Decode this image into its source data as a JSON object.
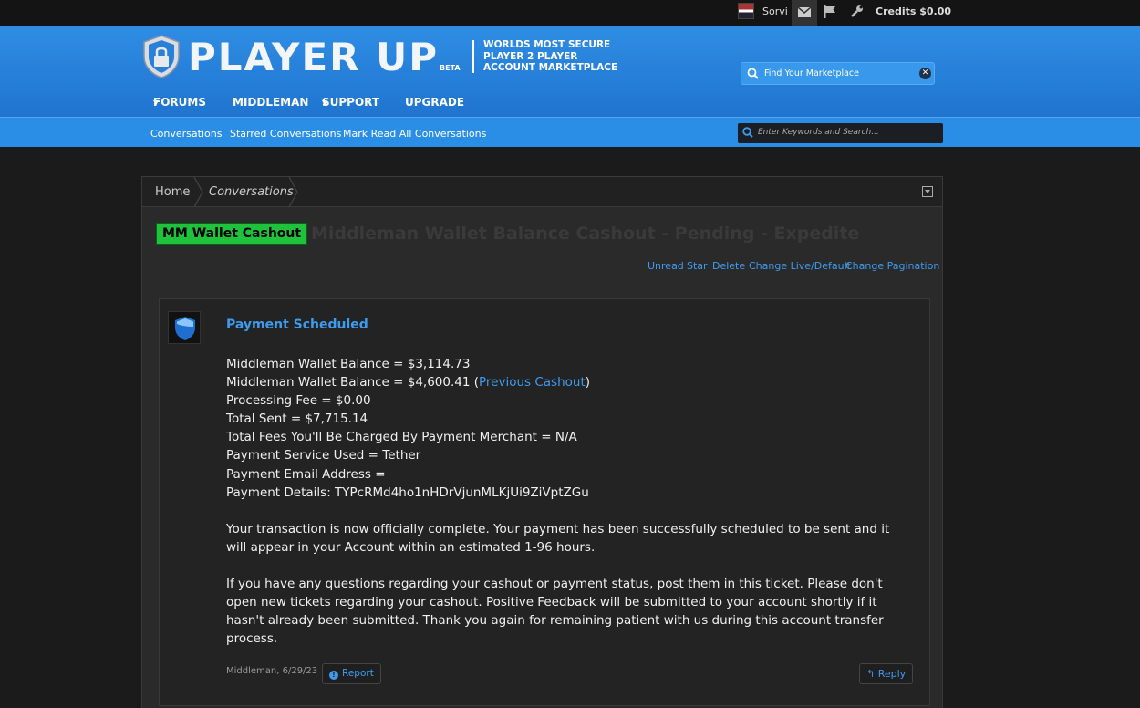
{
  "userbar": {
    "username": "Sorvi",
    "credits": "Credits $0.00",
    "icons": [
      "avatar",
      "envelope-icon",
      "flag-icon",
      "wrench-icon"
    ]
  },
  "header": {
    "logo_text": "PLAYER UP",
    "logo_beta": "BETA",
    "tagline": [
      "WORLDS MOST SECURE",
      "PLAYER 2 PLAYER",
      "ACCOUNT MARKETPLACE"
    ],
    "market_search_placeholder": "Find Your Marketplace",
    "nav": [
      {
        "label": "FORUMS",
        "dropdown": true
      },
      {
        "label": "MIDDLEMAN",
        "dropdown": false
      },
      {
        "label": "SUPPORT",
        "dropdown": true
      },
      {
        "label": "UPGRADE",
        "dropdown": false
      }
    ]
  },
  "subnav": {
    "links": [
      "Conversations",
      "Starred Conversations",
      "Mark Read All Conversations"
    ],
    "search_placeholder": "Enter Keywords and Search..."
  },
  "breadcrumb": [
    "Home",
    "Conversations"
  ],
  "thread": {
    "prefix": "MM Wallet Cashout",
    "title": "Middleman Wallet Balance Cashout - Pending - Expedite",
    "actions": [
      "Unread",
      "Star",
      "Delete",
      "Change Live/Default",
      "Change Pagination"
    ]
  },
  "message": {
    "title": "Payment Scheduled",
    "lines": {
      "l1": "Middleman Wallet Balance = $3,114.73",
      "l2_pre": "Middleman Wallet Balance = $4,600.41 (",
      "l2_link": "Previous Cashout",
      "l2_post": ")",
      "l3": "Processing Fee = $0.00",
      "l4": "Total Sent = $7,715.14",
      "l5": "Total Fees You'll Be Charged By Payment Merchant = N/A",
      "l6": "Payment Service Used = Tether",
      "l7": "Payment Email Address =",
      "l8": "Payment Details: TYPcRMd4ho1nHDrVjunMLKjUi9ZiVptZGu"
    },
    "para1": "Your transaction is now officially complete. Your payment has been successfully scheduled to be sent and it will appear in your Account within an estimated 1-96 hours.",
    "para2": "If you have any questions regarding your cashout or payment status, post them in this ticket. Please don't open new tickets regarding your cashout. Positive Feedback will be submitted to your account shortly if it hasn't already been submitted. Thank you again for remaining patient with us during this account transfer process.",
    "meta": "Middleman, 6/29/23",
    "report_label": "Report",
    "reply_label": "Reply"
  },
  "colors": {
    "header_blue": "#2a8ee6",
    "link_blue": "#3d9bf0",
    "prefix_green": "#1fc23b",
    "page_bg": "#1b1b1b"
  }
}
